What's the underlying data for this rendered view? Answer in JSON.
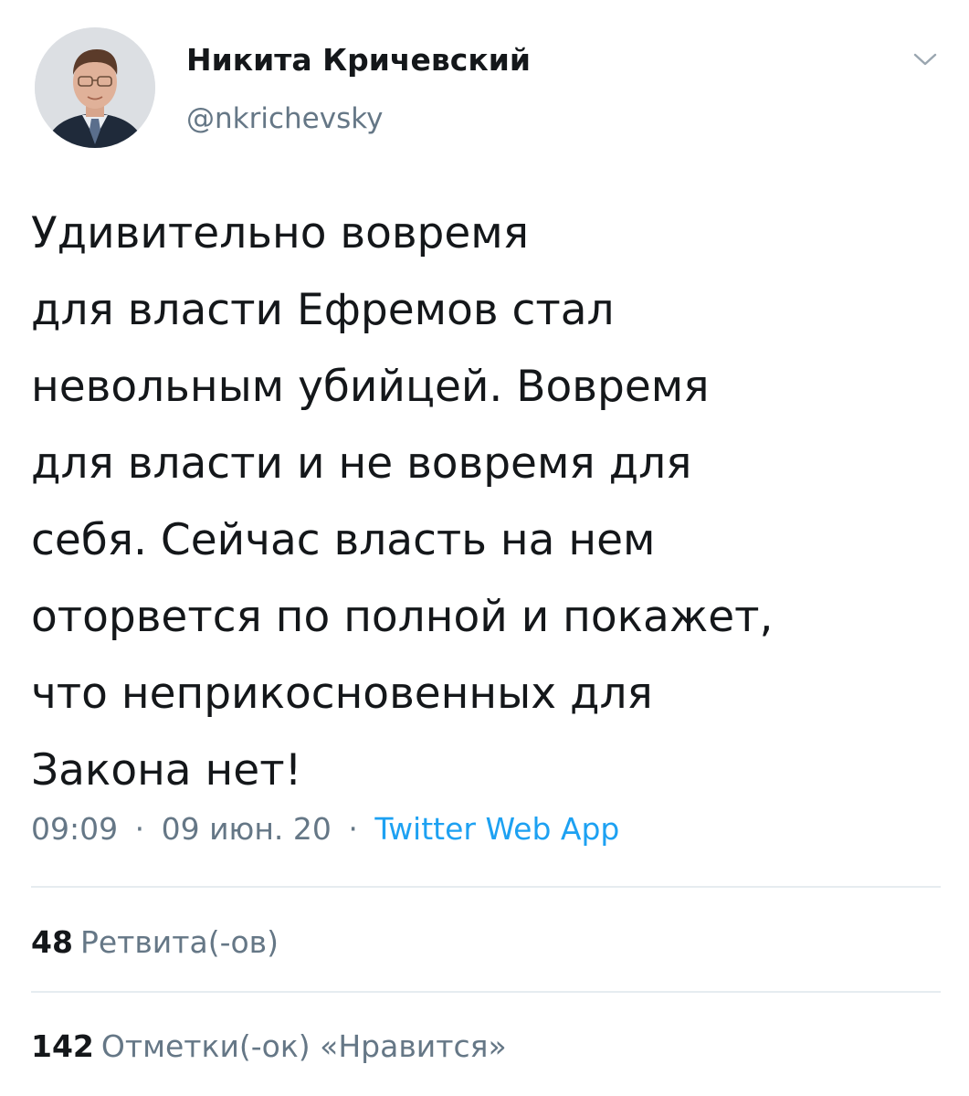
{
  "author": {
    "name": "Никита Кричевский",
    "handle": "@nkrichevsky"
  },
  "tweet": {
    "lines": [
      "Удивительно вовремя",
      "для власти Ефремов стал",
      "невольным убийцей. Вовремя",
      "для власти и не вовремя для",
      "себя. Сейчас власть на нем",
      "оторвется по полной и покажет,",
      "что неприкосновенных для",
      "Закона нет!"
    ]
  },
  "meta": {
    "time": "09:09",
    "separator": "·",
    "date": "09 июн. 20",
    "source": "Twitter Web App"
  },
  "stats": {
    "retweets": {
      "count": "48",
      "label": "Ретвита(-ов)"
    },
    "likes": {
      "count": "142",
      "label": "Отметки(-ок) «Нравится»"
    }
  },
  "icons": {
    "avatar": "profile-photo",
    "menu": "chevron-down-icon"
  },
  "colors": {
    "text": "#14171a",
    "secondary": "#657786",
    "link": "#1da1f2",
    "divider": "#e6ecf0"
  }
}
